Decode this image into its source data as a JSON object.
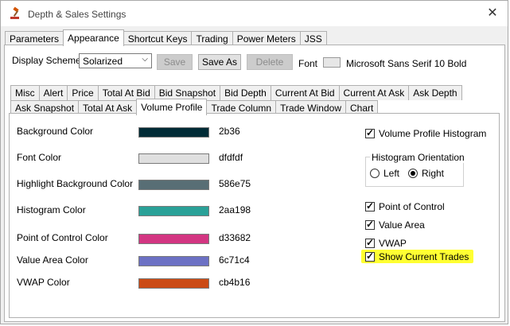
{
  "window": {
    "title": "Depth & Sales Settings",
    "close_glyph": "✕"
  },
  "main_tabs": [
    "Parameters",
    "Appearance",
    "Shortcut Keys",
    "Trading",
    "Power Meters",
    "JSS"
  ],
  "toolbar": {
    "scheme_label": "Display Scheme",
    "scheme_value": "Solarized",
    "save_label": "Save",
    "save_as_label": "Save As",
    "delete_label": "Delete",
    "font_label": "Font",
    "font_value": "Microsoft Sans Serif 10 Bold"
  },
  "sub_tabs_row1": [
    "Misc",
    "Alert",
    "Price",
    "Total At Bid",
    "Bid Snapshot",
    "Bid Depth",
    "Current At Bid",
    "Current At Ask",
    "Ask Depth"
  ],
  "sub_tabs_row2": [
    "Ask Snapshot",
    "Total At Ask",
    "Volume Profile",
    "Trade Column",
    "Trade Window",
    "Chart"
  ],
  "colors": [
    {
      "label": "Background Color",
      "hex": "2b36",
      "swatch": "#002b36"
    },
    {
      "label": "Font Color",
      "hex": "dfdfdf",
      "swatch": "#dfdfdf"
    },
    {
      "label": "Highlight Background Color",
      "hex": "586e75",
      "swatch": "#586e75"
    },
    {
      "label": "Histogram Color",
      "hex": "2aa198",
      "swatch": "#2aa198"
    },
    {
      "label": "Point of Control Color",
      "hex": "d33682",
      "swatch": "#d33682"
    },
    {
      "label": "Value Area Color",
      "hex": "6c71c4",
      "swatch": "#6c71c4"
    },
    {
      "label": "VWAP Color",
      "hex": "cb4b16",
      "swatch": "#cb4b16"
    }
  ],
  "options": {
    "volume_profile_histogram": "Volume Profile Histogram",
    "histogram_orientation": "Histogram Orientation",
    "left": "Left",
    "right": "Right",
    "point_of_control": "Point of Control",
    "value_area": "Value Area",
    "vwap": "VWAP",
    "show_current_trades": "Show Current Trades"
  },
  "accent_colors": {
    "highlight": "#ffff32"
  }
}
